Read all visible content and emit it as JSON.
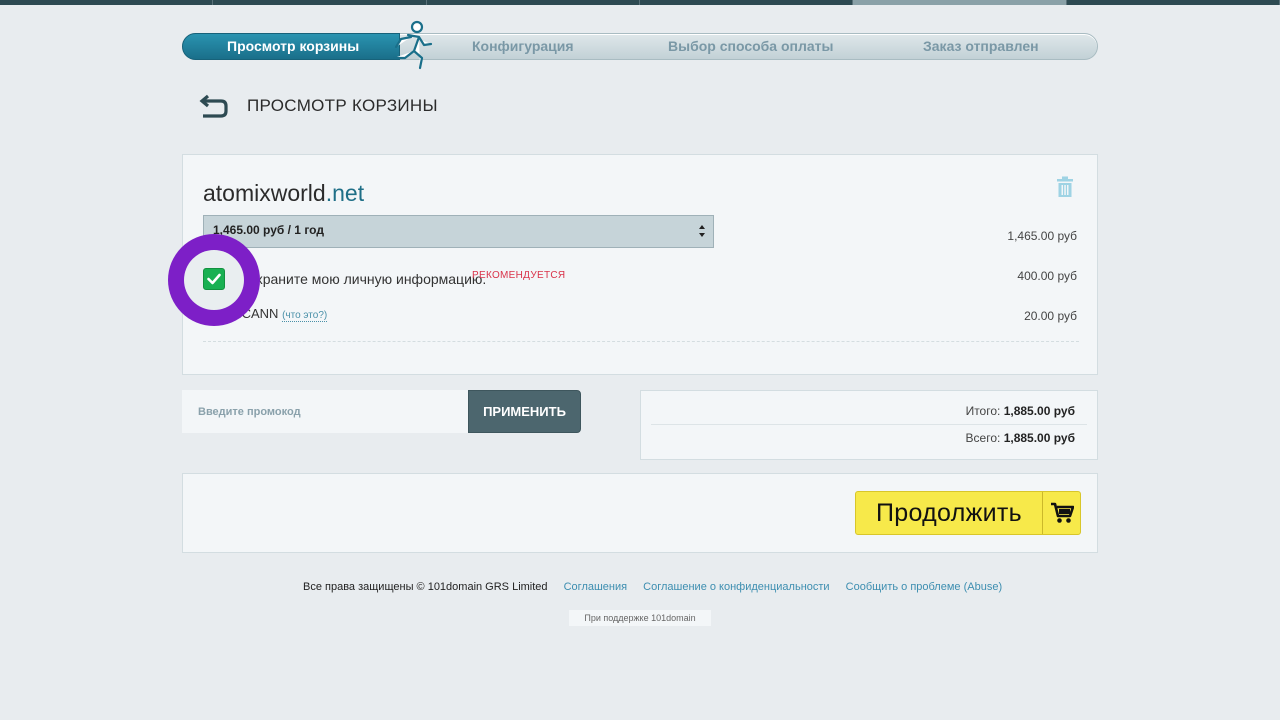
{
  "steps": [
    {
      "label": "Просмотр корзины",
      "state": "current"
    },
    {
      "label": "Конфигурация",
      "state": "upcoming"
    },
    {
      "label": "Выбор способа оплаты",
      "state": "upcoming"
    },
    {
      "label": "Заказ отправлен",
      "state": "upcoming"
    }
  ],
  "page": {
    "title": "ПРОСМОТР КОРЗИНЫ"
  },
  "cart": {
    "domain_name": "atomixworld",
    "domain_tld": ".net",
    "period_selected": "1,465.00 руб / 1 год",
    "period_price": "1,465.00 руб",
    "privacy_label": "Сохраните мою личную информацию.",
    "privacy_recommended": "РЕКОМЕНДУЕТСЯ",
    "privacy_checked": true,
    "privacy_price": "400.00 руб",
    "icann_label": "ICANN",
    "icann_whatis": "(что это?)",
    "icann_price": "20.00 руб"
  },
  "promo": {
    "placeholder": "Введите промокод",
    "apply_label": "ПРИМЕНИТЬ"
  },
  "totals": {
    "subtotal_label": "Итого:",
    "subtotal_value": "1,885.00 руб",
    "total_label": "Всего:",
    "total_value": "1,885.00 руб"
  },
  "continue_label": "Продолжить",
  "footer": {
    "copyright": "Все права защищены © 101domain GRS Limited",
    "links": [
      "Соглашения",
      "Соглашение о конфиденциальности",
      "Сообщить о проблеме (Abuse)"
    ],
    "powered": "При поддержке 101domain"
  },
  "colors": {
    "accent": "#1a6f8a",
    "continue": "#f7e94a",
    "highlight_ring": "#7d1fc7",
    "checkbox": "#19b052",
    "recommended": "#d9334a"
  }
}
